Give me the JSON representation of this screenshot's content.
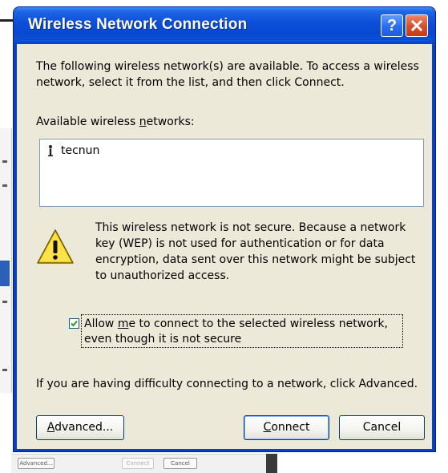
{
  "window": {
    "title": "Wireless Network Connection",
    "help_label": "?",
    "close_label": "close"
  },
  "dialog": {
    "intro": "The following wireless network(s) are available. To access a wireless network, select it from the list, and then click Connect.",
    "available_label_pre": "Available wireless ",
    "available_label_key": "n",
    "available_label_post": "etworks:",
    "networks": [
      {
        "name": "tecnun",
        "icon": "wireless-network-icon"
      }
    ],
    "warning_icon": "warning-icon",
    "warning_text": "This wireless network is not secure. Because a network key (WEP) is not used for authentication or for data encryption, data sent over this network might be subject to unauthorized access.",
    "allow": {
      "checked": true,
      "pre": "Allow ",
      "key": "m",
      "post": "e to connect to the selected wireless network, even though it is not secure"
    },
    "difficulty_text": "If you are having difficulty connecting to a network, click Advanced."
  },
  "buttons": {
    "advanced_key": "A",
    "advanced_rest": "dvanced...",
    "connect_key": "C",
    "connect_rest": "onnect",
    "cancel": "Cancel"
  },
  "background": {
    "advanced_small": "Advanced...",
    "connect_small": "Connect",
    "cancel_small": "Cancel"
  },
  "colors": {
    "titlebar": "#0a4ed8",
    "window_face": "#ece9d8",
    "close_button": "#d8512c",
    "warning_yellow": "#f7d21a"
  }
}
